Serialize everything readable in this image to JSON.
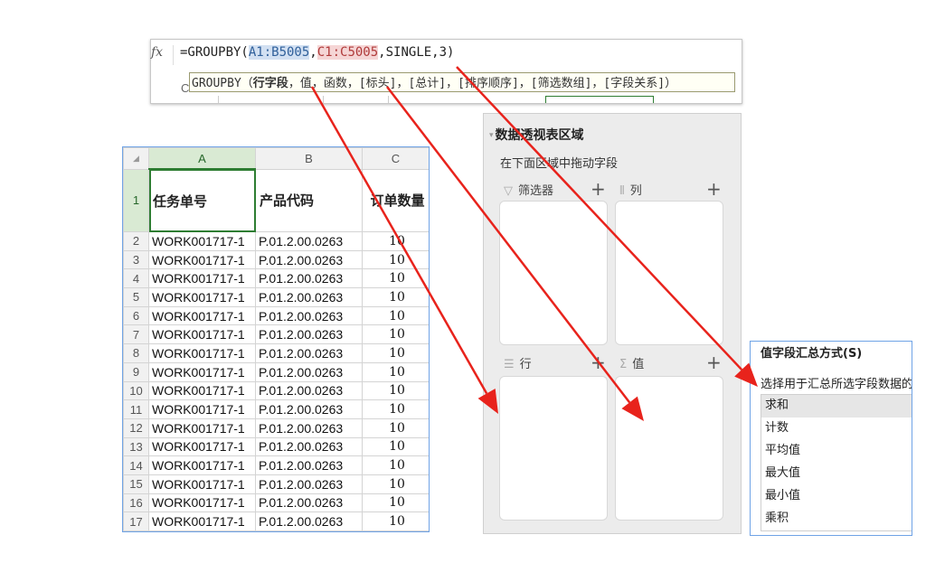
{
  "formula_bar": {
    "fx_label": "fx",
    "formula_prefix": "=GROUPBY(",
    "ref1": "A1:B5005",
    "sep1": ",",
    "ref2": "C1:C5005",
    "formula_suffix": ",SINGLE,3)",
    "tooltip_prefix": "GROUPBY（",
    "tooltip_current_arg": "行字段",
    "tooltip_rest": "，值，函数，[标头]，[总计]，[排序顺序]，[筛选数组]，[字段关系]）",
    "column_stub": "C"
  },
  "sheet": {
    "corner": "◢",
    "columns": [
      "A",
      "B",
      "C"
    ],
    "header_row": {
      "row_num": "1",
      "a": "任务单号",
      "b": "产品代码",
      "c": "订单数量"
    },
    "rows": [
      {
        "n": "2",
        "a": "WORK001717-1",
        "b": "P.01.2.00.0263",
        "c": "10"
      },
      {
        "n": "3",
        "a": "WORK001717-1",
        "b": "P.01.2.00.0263",
        "c": "10"
      },
      {
        "n": "4",
        "a": "WORK001717-1",
        "b": "P.01.2.00.0263",
        "c": "10"
      },
      {
        "n": "5",
        "a": "WORK001717-1",
        "b": "P.01.2.00.0263",
        "c": "10"
      },
      {
        "n": "6",
        "a": "WORK001717-1",
        "b": "P.01.2.00.0263",
        "c": "10"
      },
      {
        "n": "7",
        "a": "WORK001717-1",
        "b": "P.01.2.00.0263",
        "c": "10"
      },
      {
        "n": "8",
        "a": "WORK001717-1",
        "b": "P.01.2.00.0263",
        "c": "10"
      },
      {
        "n": "9",
        "a": "WORK001717-1",
        "b": "P.01.2.00.0263",
        "c": "10"
      },
      {
        "n": "10",
        "a": "WORK001717-1",
        "b": "P.01.2.00.0263",
        "c": "10"
      },
      {
        "n": "11",
        "a": "WORK001717-1",
        "b": "P.01.2.00.0263",
        "c": "10"
      },
      {
        "n": "12",
        "a": "WORK001717-1",
        "b": "P.01.2.00.0263",
        "c": "10"
      },
      {
        "n": "13",
        "a": "WORK001717-1",
        "b": "P.01.2.00.0263",
        "c": "10"
      },
      {
        "n": "14",
        "a": "WORK001717-1",
        "b": "P.01.2.00.0263",
        "c": "10"
      },
      {
        "n": "15",
        "a": "WORK001717-1",
        "b": "P.01.2.00.0263",
        "c": "10"
      },
      {
        "n": "16",
        "a": "WORK001717-1",
        "b": "P.01.2.00.0263",
        "c": "10"
      },
      {
        "n": "17",
        "a": "WORK001717-1",
        "b": "P.01.2.00.0263",
        "c": "10"
      }
    ]
  },
  "pivot": {
    "title": "数据透视表区域",
    "subtitle": "在下面区域中拖动字段",
    "filter_label": "筛选器",
    "column_label": "列",
    "row_label": "行",
    "value_label": "值",
    "plus": "+"
  },
  "value_panel": {
    "title": "值字段汇总方式(S)",
    "description": "选择用于汇总所选字段数据的",
    "options": [
      "求和",
      "计数",
      "平均值",
      "最大值",
      "最小值",
      "乘积"
    ],
    "selected": "求和"
  },
  "colors": {
    "arrow": "#e8231c",
    "selection_green": "#2e7d32",
    "panel_border_blue": "#6fa3e6"
  }
}
